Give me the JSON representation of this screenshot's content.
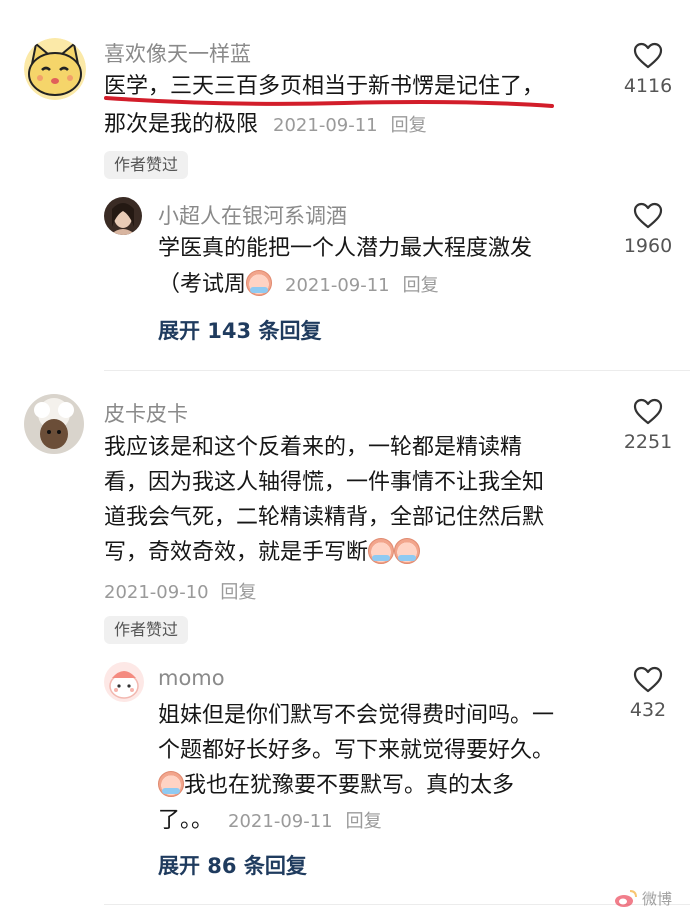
{
  "comments": [
    {
      "username": "喜欢像天一样蓝",
      "line1": "医学，三天三百多页相当于新书愣是记住了，",
      "line2": "那次是我的极限",
      "date": "2021-09-11",
      "reply_label": "回复",
      "likes": "4116",
      "author_liked": "作者赞过",
      "reply": {
        "username": "小超人在银河系调酒",
        "line1": "学医真的能把一个人潜力最大程度激发",
        "line2": "（考试周",
        "date": "2021-09-11",
        "reply_label": "回复",
        "likes": "1960"
      },
      "expand_label": "展开 143 条回复"
    },
    {
      "username": "皮卡皮卡",
      "line1": "我应该是和这个反着来的，一轮都是精读精",
      "line2": "看，因为我这人轴得慌，一件事情不让我全知",
      "line3": "道我会气死，二轮精读精背，全部记住然后默",
      "line4": "写，奇效奇效，就是手写断",
      "date": "2021-09-10",
      "reply_label": "回复",
      "likes": "2251",
      "author_liked": "作者赞过",
      "reply": {
        "username": "momo",
        "line1": "姐妹但是你们默写不会觉得费时间吗。一",
        "line2": "个题都好长好多。写下来就觉得要好久。",
        "line3": "我也在犹豫要不要默写。真的太多",
        "line4": "了。。",
        "date": "2021-09-11",
        "reply_label": "回复",
        "likes": "432"
      },
      "expand_label": "展开 86 条回复"
    }
  ],
  "watermark": "微博",
  "colors": {
    "username": "#8a8a8a",
    "meta": "#9a9a9a",
    "expand_link": "#1f3b5e",
    "underline": "#d21d2a"
  }
}
